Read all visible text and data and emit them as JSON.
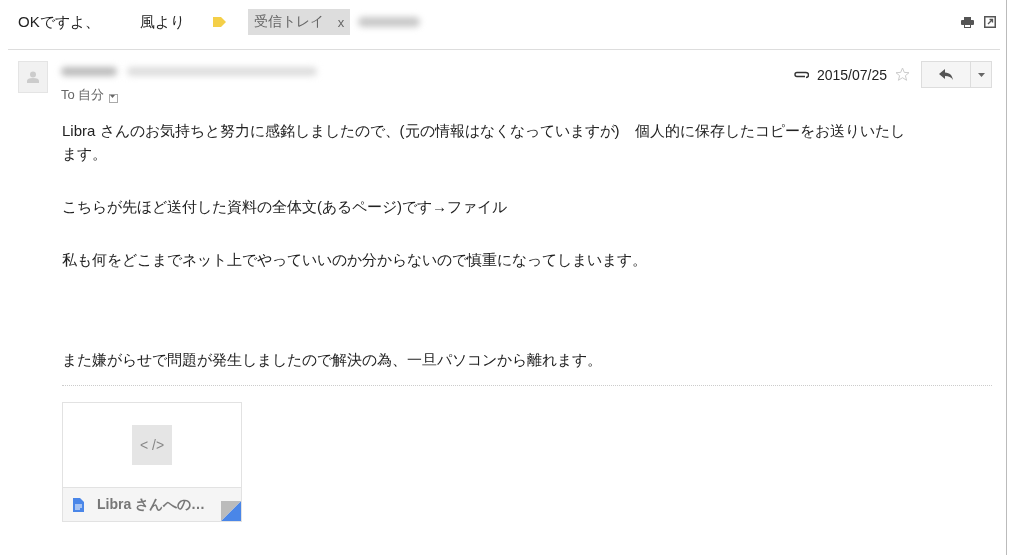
{
  "subject": {
    "parts": [
      "OKですよ、",
      "風より"
    ],
    "labels": [
      {
        "kind": "chip",
        "text": "受信トレイ",
        "remove": "x"
      },
      {
        "kind": "blurred"
      }
    ]
  },
  "message": {
    "sender": {
      "kind": "blurred"
    },
    "recipient": "To 自分",
    "date": "2015/07/25",
    "has_attachment": true,
    "starred": false,
    "paragraphs": [
      "Libra さんのお気持ちと努力に感銘しましたので、(元の情報はなくなっていますが)　個人的に保存したコピーをお送りいたします。",
      "こちらが先ほど送付した資料の全体文(あるページ)です→ファイル",
      "私も何をどこまでネット上でやっていいのか分からないので慎重になってしまいます。",
      "また嫌がらせで問題が発生しましたので解決の為、一旦パソコンから離れます。"
    ],
    "attachments": [
      {
        "thumbnail_glyph": "< />",
        "name": "Libra さんへの…"
      }
    ]
  }
}
